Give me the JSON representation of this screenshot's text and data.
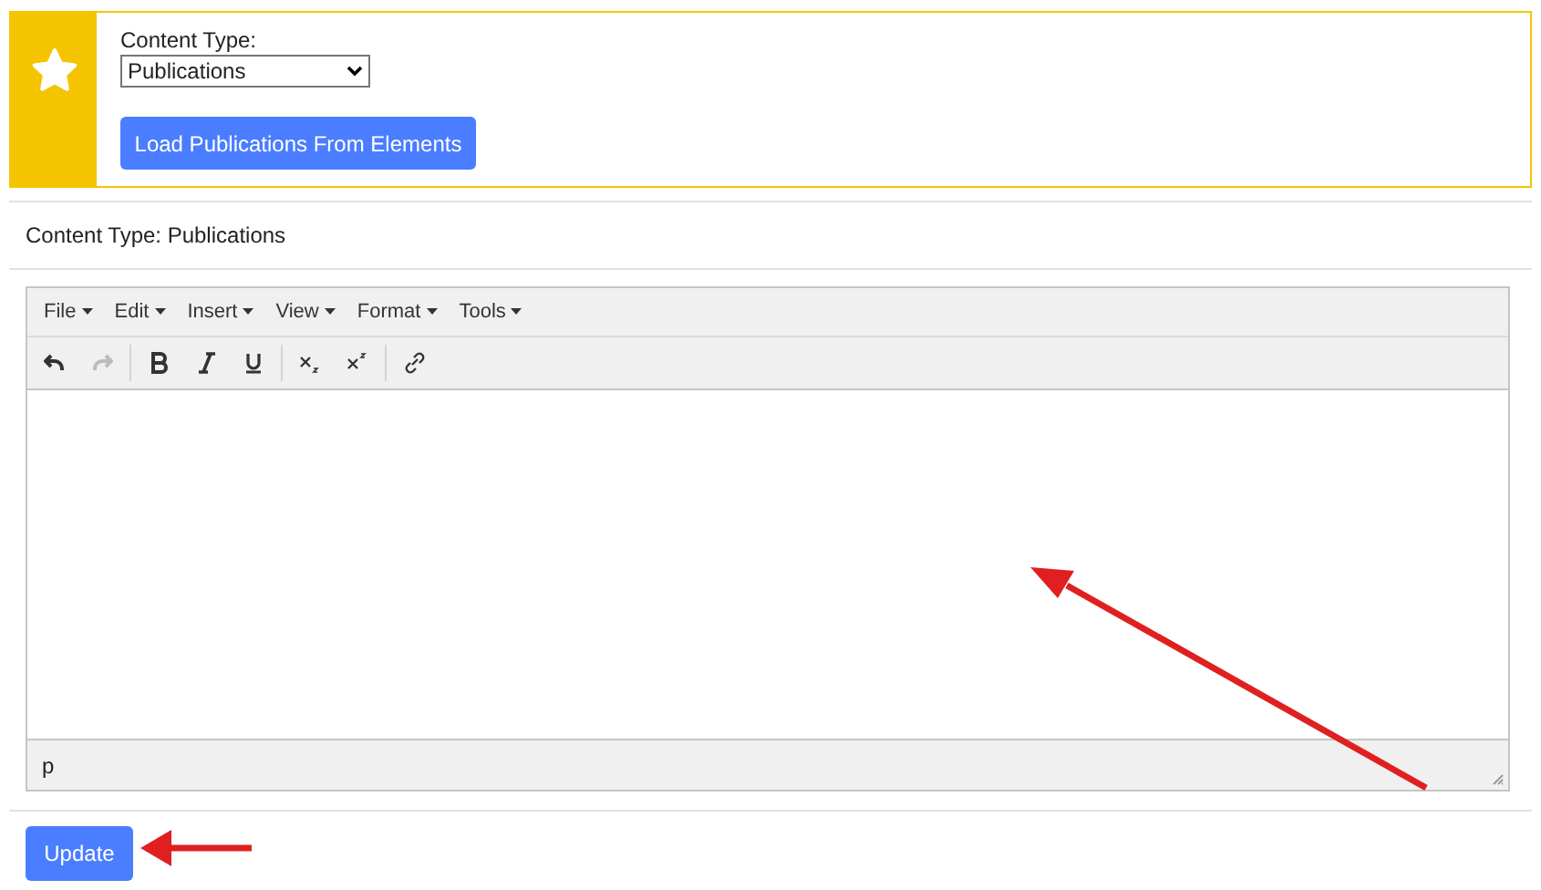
{
  "content_type_field": {
    "label": "Content Type:",
    "value": "Publications"
  },
  "load_button": "Load Publications From Elements",
  "content_type_summary": "Content Type: Publications",
  "editor": {
    "menus": [
      "File",
      "Edit",
      "Insert",
      "View",
      "Format",
      "Tools"
    ],
    "toolbar_groups": [
      [
        {
          "kind": "undo",
          "disabled": false
        },
        {
          "kind": "redo",
          "disabled": true
        }
      ],
      [
        {
          "kind": "bold",
          "disabled": false
        },
        {
          "kind": "italic",
          "disabled": false
        },
        {
          "kind": "underline",
          "disabled": false
        }
      ],
      [
        {
          "kind": "subscript",
          "disabled": false
        },
        {
          "kind": "superscript",
          "disabled": false
        }
      ],
      [
        {
          "kind": "link",
          "disabled": false
        }
      ]
    ],
    "status_path": "p"
  },
  "update_button": "Update"
}
